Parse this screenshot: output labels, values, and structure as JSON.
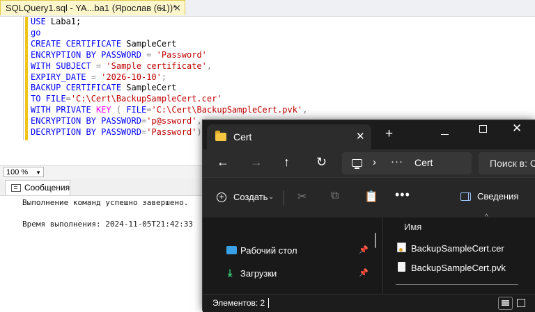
{
  "ssms": {
    "tab_title": "SQLQuery1.sql - YA...ba1 (Ярослав (61))*",
    "tab_pin_icon": "pin-icon",
    "tab_close_icon": "close-icon",
    "code": {
      "use_kw": "USE",
      "use_db": " Laba1;",
      "go_kw": "go",
      "create_kw": "CREATE CERTIFICATE",
      "cert_name": " SampleCert",
      "enc_kw": "ENCRYPTION BY PASSWORD",
      "enc_eq": " = ",
      "enc_pwd": "'Password'",
      "subj_kw": "WITH SUBJECT",
      "subj_eq": " = ",
      "subj_val": "'Sample certificate'",
      "comma1": ",",
      "exp_kw": "EXPIRY_DATE",
      "exp_eq": " = ",
      "exp_val": "'2026-10-10'",
      "semi1": ";",
      "backup_kw": "BACKUP CERTIFICATE",
      "backup_name": " SampleCert",
      "to_kw": "TO FILE",
      "to_eq": "=",
      "to_val": "'C:\\Cert\\BackupSampleCert.cer'",
      "with_kw": "WITH PRIVATE",
      "key_kw": "KEY",
      "key_open": " ( ",
      "file_kw": "FILE",
      "file_eq": "=",
      "file_val": "'C:\\Cert\\BackupSampleCert.pvk'",
      "comma2": ",",
      "enc2_kw": "ENCRYPTION BY PASSWORD",
      "enc2_eq": "=",
      "enc2_val": "'p@ssword'",
      "comma3": ",",
      "dec_kw": "DECRYPTION BY PASSWORD",
      "dec_eq": "=",
      "dec_val": "'Password'",
      "close_paren": ")"
    },
    "zoom": "100 %",
    "messages_tab": "Сообщения",
    "messages": [
      "Выполнение команд успешно завершено.",
      "Время выполнения: 2024-11-05T21:42:33"
    ]
  },
  "explorer": {
    "tab_title": "Cert",
    "new_tab": "+",
    "window_controls": {
      "minimize": "minimize-icon",
      "maximize": "maximize-icon",
      "close": "✕"
    },
    "nav": {
      "back": "←",
      "forward": "→",
      "up": "↑",
      "refresh": "↻"
    },
    "path": {
      "chevron": "›",
      "dots": "···",
      "segment": "Cert"
    },
    "search_placeholder": "Поиск в: C",
    "toolbar": {
      "create_label": "Создать",
      "create_chevron": "⌄",
      "cut_icon": "✂",
      "copy_icon": "⧉",
      "paste_icon": "📋",
      "more": "•••",
      "details_label": "Сведения"
    },
    "nav_pane": [
      {
        "label": "Рабочий стол",
        "icon": "desktop-icon",
        "pin": "📌"
      },
      {
        "label": "Загрузки",
        "icon": "download-icon",
        "glyph": "⤓",
        "pin": "📌"
      }
    ],
    "column_header": "Имя",
    "sort_indicator": "^",
    "files": [
      {
        "name": "BackupSampleCert.cer",
        "icon": "certificate-file-icon"
      },
      {
        "name": "BackupSampleCert.pvk",
        "icon": "file-icon"
      }
    ],
    "status_text": "Элементов: 2"
  },
  "colors": {
    "sql_keyword": "#0000ff",
    "sql_string": "#c00000",
    "sql_function": "#ff00ff",
    "sql_operator": "#808080",
    "explorer_background": "#202020",
    "tab_highlight": "#fff7cc"
  }
}
